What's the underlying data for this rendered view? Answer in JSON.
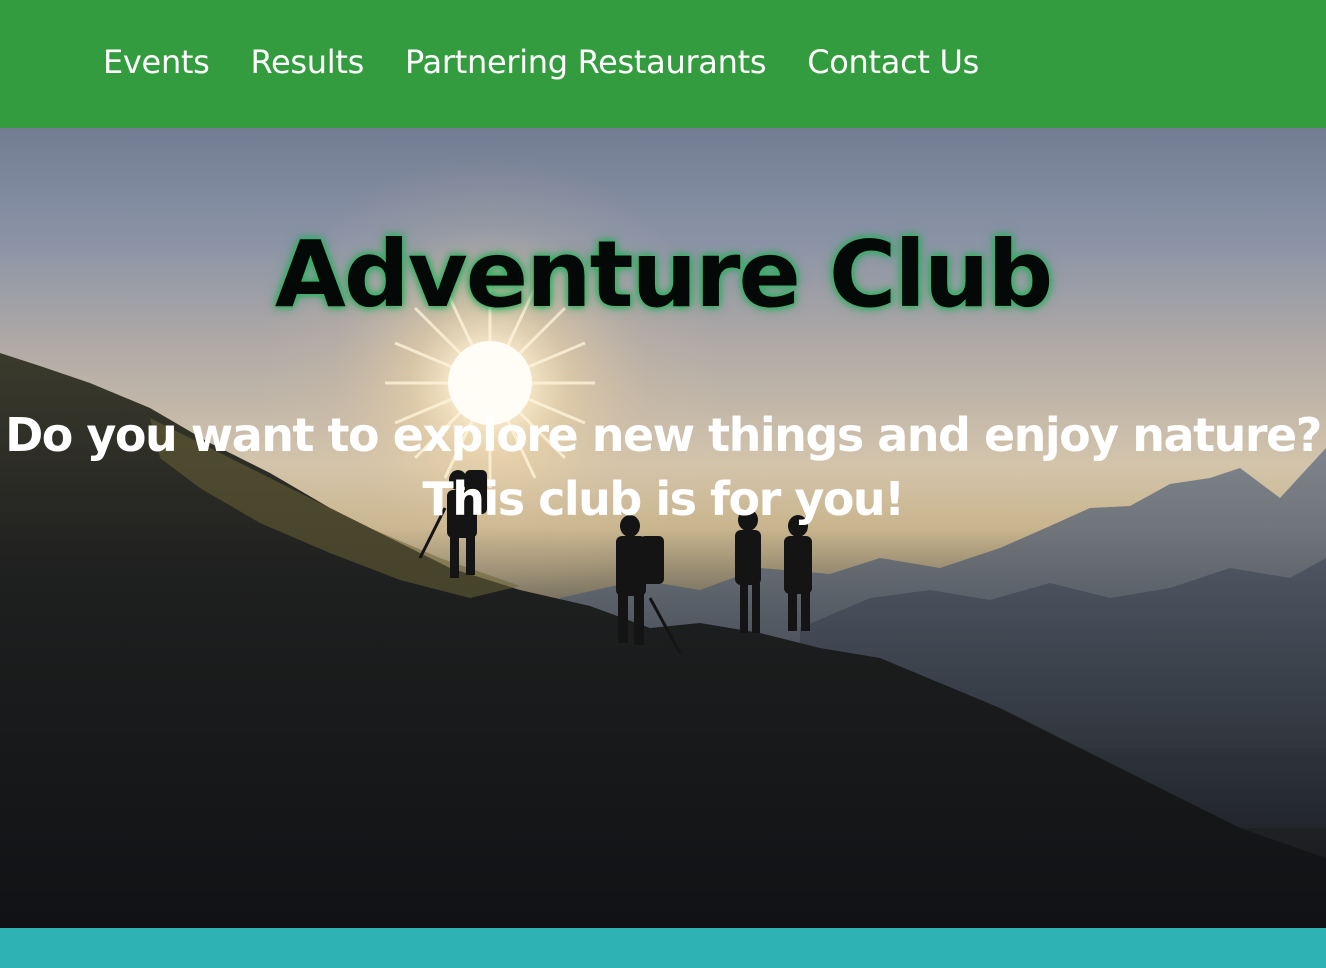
{
  "nav": {
    "items": [
      {
        "label": "Events"
      },
      {
        "label": "Results"
      },
      {
        "label": "Partnering Restaurants"
      },
      {
        "label": "Contact Us"
      }
    ]
  },
  "hero": {
    "title": "Adventure Club",
    "tagline_line1": "Do you want to explore new things and enjoy nature?",
    "tagline_line2": "This club is for you!",
    "image_description_icon": "mountain-hikers-sunset-photo"
  },
  "colors": {
    "nav_background": "#339c3e",
    "nav_text": "#ffffff",
    "title_text": "#040806",
    "title_glow": "#34c46a",
    "tagline_text": "#ffffff",
    "footer_band": "#2eb2b3"
  }
}
